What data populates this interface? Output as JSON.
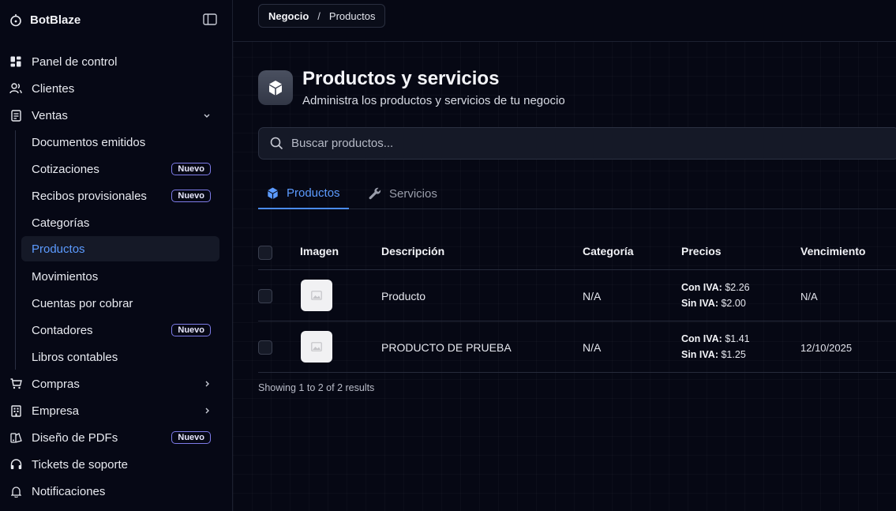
{
  "app": {
    "name": "BotBlaze"
  },
  "sidebar": {
    "items": [
      {
        "label": "Panel de control",
        "icon": "dashboard-icon"
      },
      {
        "label": "Clientes",
        "icon": "users-icon"
      },
      {
        "label": "Ventas",
        "icon": "receipt-icon",
        "expanded": true
      },
      {
        "label": "Compras",
        "icon": "cart-icon"
      },
      {
        "label": "Empresa",
        "icon": "building-icon"
      },
      {
        "label": "Diseño de PDFs",
        "icon": "palette-icon",
        "badge": "Nuevo"
      },
      {
        "label": "Tickets de soporte",
        "icon": "headset-icon"
      },
      {
        "label": "Notificaciones",
        "icon": "bell-icon"
      }
    ],
    "ventas_sub": [
      {
        "label": "Documentos emitidos"
      },
      {
        "label": "Cotizaciones",
        "badge": "Nuevo"
      },
      {
        "label": "Recibos provisionales",
        "badge": "Nuevo"
      },
      {
        "label": "Categorías"
      },
      {
        "label": "Productos",
        "active": true
      },
      {
        "label": "Movimientos"
      },
      {
        "label": "Cuentas por cobrar"
      },
      {
        "label": "Contadores",
        "badge": "Nuevo"
      },
      {
        "label": "Libros contables"
      }
    ]
  },
  "breadcrumb": {
    "first": "Negocio",
    "separator": "/",
    "current": "Productos"
  },
  "page": {
    "title": "Productos y servicios",
    "subtitle": "Administra los productos y servicios de tu negocio"
  },
  "search": {
    "placeholder": "Buscar productos...",
    "value": ""
  },
  "tabs": [
    {
      "label": "Productos",
      "icon": "cube-icon",
      "active": true
    },
    {
      "label": "Servicios",
      "icon": "wrench-icon",
      "active": false
    }
  ],
  "table": {
    "headers": [
      "Imagen",
      "Descripción",
      "Categoría",
      "Precios",
      "Vencimiento"
    ],
    "rows": [
      {
        "description": "Producto",
        "category": "N/A",
        "price_con_label": "Con IVA:",
        "price_con": "$2.26",
        "price_sin_label": "Sin IVA:",
        "price_sin": "$2.00",
        "expiry": "N/A"
      },
      {
        "description": "PRODUCTO DE PRUEBA",
        "category": "N/A",
        "price_con_label": "Con IVA:",
        "price_con": "$1.41",
        "price_sin_label": "Sin IVA:",
        "price_sin": "$1.25",
        "expiry": "12/10/2025"
      }
    ],
    "footer": "Showing 1 to 2 of 2 results"
  },
  "colors": {
    "accent": "#5c9bff",
    "badge_border": "#7d7be8",
    "background": "#050712"
  }
}
